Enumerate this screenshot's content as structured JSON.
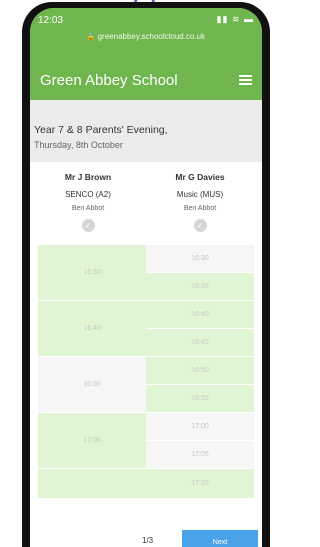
{
  "decor": {
    "mark": "||"
  },
  "status_bar": {
    "time": "12:03",
    "icons": "▮▮ ≋ ▬"
  },
  "browser": {
    "url": "greenabbey.schoolcloud.co.uk"
  },
  "app": {
    "title": "Green Abbey School"
  },
  "event": {
    "name": "Year 7 & 8 Parents' Evening,",
    "date": "Thursday, 8th October"
  },
  "teachers": [
    {
      "name": "Mr J Brown",
      "subject": "SENCO (A2)",
      "pupil": "Ben Abbot"
    },
    {
      "name": "Mr G Davies",
      "subject": "Music (MUS)",
      "pupil": "Ben Abbot"
    }
  ],
  "slots": {
    "left": [
      {
        "time": "16:30",
        "state": "green"
      },
      {
        "time": "16:40",
        "state": "green"
      },
      {
        "time": "16:50",
        "state": "grey"
      },
      {
        "time": "17:00",
        "state": "green"
      },
      {
        "time": "",
        "state": "green"
      }
    ],
    "right": [
      {
        "time": "16:30",
        "state": "grey"
      },
      {
        "time": "16:35",
        "state": "green"
      },
      {
        "time": "16:40",
        "state": "green"
      },
      {
        "time": "16:45",
        "state": "green"
      },
      {
        "time": "16:50",
        "state": "green"
      },
      {
        "time": "16:55",
        "state": "green"
      },
      {
        "time": "17:00",
        "state": "grey"
      },
      {
        "time": "17:05",
        "state": "grey"
      },
      {
        "time": "17:10",
        "state": "green"
      }
    ]
  },
  "footer": {
    "page": "1/3",
    "next_label": "Next"
  },
  "colors": {
    "brand": "#6fb64f",
    "slot_available": "#dff5d3",
    "slot_unavailable": "#f6f6f6",
    "next": "#4aa3e8"
  }
}
